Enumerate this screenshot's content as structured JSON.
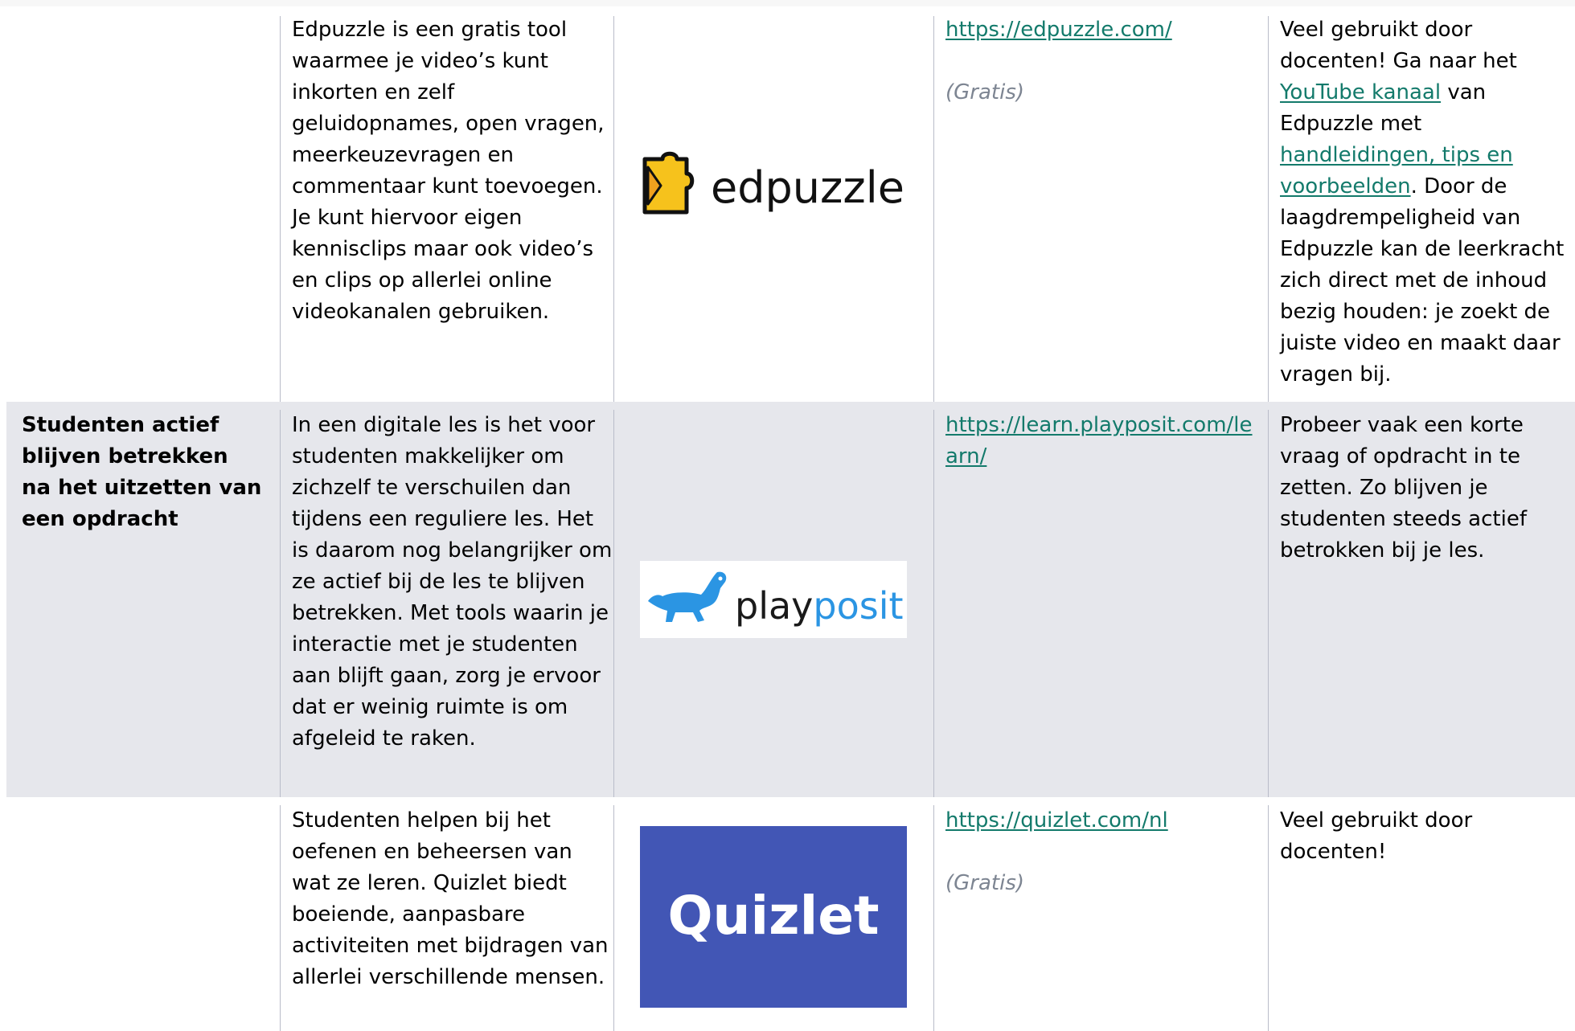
{
  "rows": [
    {
      "goal": "",
      "description": "Edpuzzle is een gratis tool waarmee je video’s kunt inkorten en zelf geluidopnames, open vragen, meerkeuzevragen en commentaar kunt toevoegen. Je kunt hiervoor eigen kennisclips maar ook video’s en clips op allerlei online videokanalen gebruiken.",
      "logo": {
        "name": "edpuzzle-logo",
        "text": "edpuzzle"
      },
      "link": "https://edpuzzle.com/",
      "price": "(Gratis)",
      "tips": {
        "t1": "Veel gebruikt door docenten! Ga naar het ",
        "link1": "YouTube kanaal",
        "t2": " van Edpuzzle met ",
        "link2": "handleidingen, tips en voorbeelden",
        "t3": ". Door de laagdrempeligheid van Edpuzzle kan de leerkracht zich direct met de inhoud bezig houden: je zoekt de juiste video en maakt daar vragen bij."
      }
    },
    {
      "goal": "Studenten actief blijven betrekken na het uitzetten van een opdracht",
      "description": "In een digitale les is het voor studenten makkelijker om zichzelf te verschuilen dan tijdens een reguliere les. Het is daarom nog belangrijker om ze actief bij de les te blijven betrekken. Met tools waarin je interactie met je studenten aan blijft gaan, zorg je ervoor dat er weinig ruimte is om afgeleid te raken.",
      "logo": {
        "name": "playposit-logo",
        "text_dark": "play",
        "text_blue": "posit"
      },
      "link": "https://learn.playposit.com/learn/",
      "tips": {
        "t1": "Probeer vaak een korte vraag of opdracht in te zetten. Zo blijven je studenten steeds actief betrokken bij je les."
      }
    },
    {
      "goal": "",
      "description": "Studenten helpen bij het oefenen en beheersen van wat ze leren. Quizlet biedt boeiende, aanpasbare activiteiten met bijdragen van allerlei verschillende mensen.",
      "logo": {
        "name": "quizlet-logo",
        "text": "Quizlet"
      },
      "link": "https://quizlet.com/nl",
      "price": "(Gratis)",
      "tips": {
        "t1": "Veel gebruikt door docenten!"
      }
    }
  ],
  "colors": {
    "link": "#137a6b",
    "shaded_row": "#e6e7ec",
    "edpuzzle_yellow": "#f6c21c",
    "playposit_blue": "#2b95e3",
    "quizlet_blue": "#4256b5"
  }
}
